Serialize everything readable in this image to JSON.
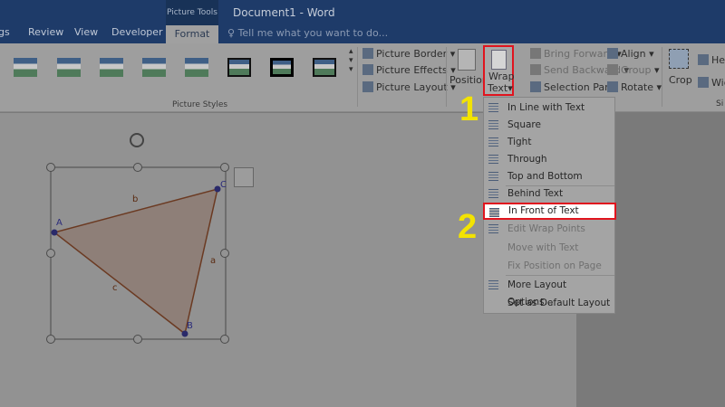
{
  "titlebar": {
    "context_tab": "Picture Tools",
    "title": "Document1 - Word"
  },
  "tabs": [
    {
      "label": "gs"
    },
    {
      "label": "Review"
    },
    {
      "label": "View"
    },
    {
      "label": "Developer"
    },
    {
      "label": "Format",
      "active": true
    }
  ],
  "tell_me": "Tell me what you want to do...",
  "ribbon": {
    "picture_styles_label": "Picture Styles",
    "picture_border": "Picture Border",
    "picture_effects": "Picture Effects",
    "picture_layout": "Picture Layout",
    "position": "Position",
    "wrap_text_1": "Wrap",
    "wrap_text_2": "Text",
    "bring_forward": "Bring Forward",
    "send_backward": "Send Backward",
    "selection_pane": "Selection Pane",
    "align": "Align",
    "group": "Group",
    "rotate": "Rotate",
    "crop": "Crop",
    "height": "Heig",
    "width": "Wid",
    "size_label": "Si"
  },
  "wrap_menu": {
    "items": [
      {
        "label": "In Line with Text",
        "enabled": true
      },
      {
        "label": "Square",
        "enabled": true
      },
      {
        "label": "Tight",
        "enabled": true
      },
      {
        "label": "Through",
        "enabled": true
      },
      {
        "label": "Top and Bottom",
        "enabled": true
      },
      {
        "label": "Behind Text",
        "enabled": true
      },
      {
        "label": "In Front of Text",
        "enabled": true,
        "highlighted": true
      },
      {
        "label": "Edit Wrap Points",
        "enabled": false
      },
      {
        "label": "Move with Text",
        "enabled": false
      },
      {
        "label": "Fix Position on Page",
        "enabled": false
      },
      {
        "label": "More Layout Options...",
        "enabled": true
      },
      {
        "label": "Set as Default Layout",
        "enabled": true
      }
    ]
  },
  "steps": [
    "1",
    "2"
  ],
  "triangle": {
    "vertices": [
      "A",
      "B",
      "C"
    ],
    "sides": [
      "a",
      "b",
      "c"
    ]
  },
  "colors": {
    "highlight": "#e0141e",
    "step_marker": "#f3e300",
    "title_bar": "#1e3b69"
  }
}
